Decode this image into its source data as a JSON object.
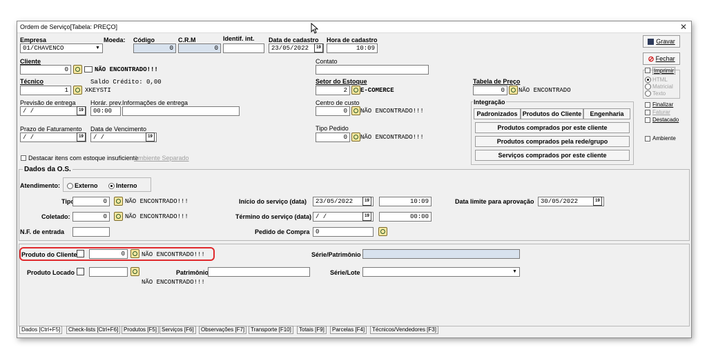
{
  "window": {
    "title": "Ordem de Serviço[Tabela: PREÇO]",
    "close": "✕"
  },
  "top": {
    "empresa_label": "Empresa",
    "empresa_value": "01/CHAVENCO",
    "moeda_label": "Moeda:",
    "codigo_label": "Código",
    "codigo_value": "0",
    "crm_label": "C.R.M",
    "crm_value": "0",
    "identif_label": "Identif. int.",
    "identif_value": "",
    "data_cad_label": "Data de cadastro",
    "data_cad_value": "23/05/2022",
    "hora_cad_label": "Hora de cadastro",
    "hora_cad_value": "10:09",
    "contato_label": "Contato",
    "contato_value": ""
  },
  "cliente": {
    "label": "Cliente",
    "value": "0",
    "status": "NÃO ENCONTRADO!!!"
  },
  "tecnico": {
    "label": "Técnico",
    "value": "1",
    "name": "XKEYSTI",
    "saldo": "Saldo Crédito: 0,00"
  },
  "setor": {
    "label": "Setor do Estoque",
    "value": "2",
    "name": "E-COMERCE"
  },
  "tabela_preco": {
    "label": "Tabela de Preço",
    "value": "0",
    "status": "NÃO ENCONTRADO"
  },
  "previsao": {
    "label": "Previsão de entrega",
    "value": " /  /",
    "hora_label": "Horár. prev.",
    "hora_value": "00:00",
    "info_label": "Informações de entrega",
    "info_value": ""
  },
  "centro": {
    "label": "Centro de custo",
    "value": "0",
    "status": "NÃO ENCONTRADO!!!"
  },
  "integracao": {
    "label": "Integração",
    "tabs": [
      "Padronizados",
      "Produtos do Cliente",
      "Engenharia"
    ],
    "buttons": [
      "Produtos comprados por este cliente",
      "Produtos comprados pela rede/grupo",
      "Serviços comprados por este cliente"
    ]
  },
  "prazo": {
    "label": "Prazo de Faturamento",
    "value": " /  /",
    "venc_label": "Data de Vencimento",
    "venc_value": " /  /"
  },
  "tipo_pedido": {
    "label": "Tipo Pedido",
    "value": "0",
    "status": "NÃO ENCONTRADO!!!"
  },
  "destacar": {
    "label": "Destacar itens com estoque insuficiente",
    "separado": "Ambiente Separado"
  },
  "side": {
    "gravar": "Gravar",
    "fechar": "Fechar",
    "imprimir": "Imprimir",
    "html": "HTML",
    "matricial": "Matricial",
    "texto": "Texto",
    "finalizar": "Finalizar",
    "faturar": "Faturar",
    "destacado": "Destacado",
    "ambiente": "Ambiente"
  },
  "dados": {
    "label": "Dados da O.S.",
    "atendimento_label": "Atendimento:",
    "externo": "Externo",
    "interno": "Interno",
    "tipo_label": "Tipo:",
    "tipo_value": "0",
    "tipo_status": "NÃO ENCONTRADO!!!",
    "coletado_label": "Coletado:",
    "coletado_value": "0",
    "coletado_status": "NÃO ENCONTRADO!!!",
    "nf_label": "N.F. de entrada",
    "nf_value": "",
    "inicio_label": "Início do serviço (data)",
    "inicio_value": "23/05/2022",
    "inicio_hora": "10:09",
    "termino_label": "Término do serviço (data)",
    "termino_value": " /  /",
    "termino_hora": "00:00",
    "pedido_label": "Pedido de Compra",
    "pedido_value": "0",
    "limite_label": "Data limite para aprovação",
    "limite_value": "30/05/2022"
  },
  "produto": {
    "cliente_label": "Produto do Cliente",
    "cliente_value": "0",
    "cliente_status": "NÃO ENCONTRADO!!!",
    "serie_pat_label": "Série/Patrimônio",
    "serie_pat_value": "",
    "locado_label": "Produto Locado",
    "locado_value": "",
    "locado_status": "NÃO ENCONTRADO!!!",
    "patrimonio_label": "Patrimônio",
    "patrimonio_value": "",
    "serie_lote_label": "Série/Lote",
    "serie_lote_value": ""
  },
  "tabs": [
    "Dados [Ctrl+F5]",
    "Check-lists [Ctrl+F6]",
    "Produtos [F5]",
    "Serviços [F6]",
    "Observações [F7]",
    "Transporte [F10]",
    "Totais [F9]",
    "Parcelas [F4]",
    "Técnicos/Vendedores [F3]"
  ],
  "icons": {
    "cal": "19"
  }
}
